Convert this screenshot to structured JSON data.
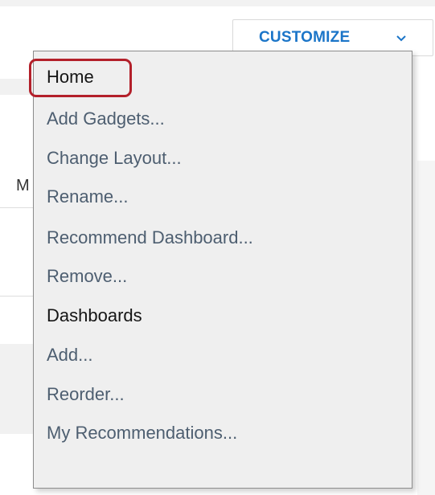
{
  "toolbar": {
    "customize_label": "CUSTOMIZE",
    "chevron_icon": "chevron-down-icon",
    "accent_color": "#1b75c8"
  },
  "background": {
    "partial_letter": "M"
  },
  "menu": {
    "sections": [
      {
        "header": "Home",
        "items": [
          "Add Gadgets...",
          "Change Layout...",
          "Rename...",
          "Recommend Dashboard...",
          "Remove..."
        ]
      },
      {
        "header": "Dashboards",
        "items": [
          "Add...",
          "Reorder...",
          "My Recommendations..."
        ]
      }
    ],
    "link_color": "#4d5e70",
    "highlight_color": "#b3202a"
  }
}
